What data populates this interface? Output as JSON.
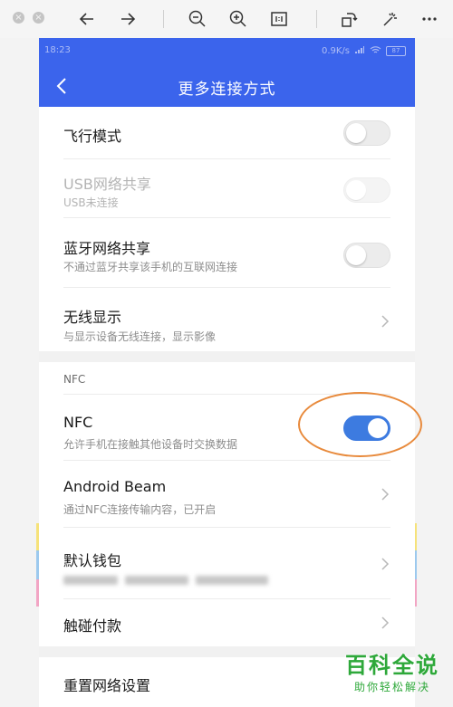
{
  "colors": {
    "header": "#3b64ec",
    "toggle_on": "#3d7be0",
    "highlight": "#e88a3c",
    "watermark": "#2ea83a"
  },
  "toolbar": {
    "icons": [
      "close-window-icon",
      "minimize-window-icon",
      "back-arrow-icon",
      "forward-arrow-icon",
      "zoom-out-icon",
      "zoom-in-icon",
      "actual-size-icon",
      "rotate-icon",
      "magic-wand-icon",
      "more-icon"
    ]
  },
  "status_bar": {
    "time": "18:23",
    "speed": "0.9K/s",
    "battery": "87"
  },
  "header": {
    "title": "更多连接方式"
  },
  "settings": {
    "airplane": {
      "title": "飞行模式",
      "toggle": "off"
    },
    "usb_tether": {
      "title": "USB网络共享",
      "subtitle": "USB未连接",
      "toggle": "disabled"
    },
    "bt_tether": {
      "title": "蓝牙网络共享",
      "subtitle": "不通过蓝牙共享该手机的互联网连接",
      "toggle": "off"
    },
    "wireless_display": {
      "title": "无线显示",
      "subtitle": "与显示设备无线连接，显示影像"
    }
  },
  "nfc_section": {
    "label": "NFC",
    "nfc": {
      "title": "NFC",
      "subtitle": "允许手机在接触其他设备时交换数据",
      "toggle": "on"
    },
    "android_beam": {
      "title": "Android Beam",
      "subtitle": "通过NFC连接传输内容，已开启"
    },
    "default_wallet": {
      "title": "默认钱包"
    },
    "tap_to_pay": {
      "title": "触碰付款"
    }
  },
  "reset": {
    "title": "重置网络设置"
  },
  "watermark": {
    "title": "百科全说",
    "subtitle": "助你轻松解决"
  }
}
